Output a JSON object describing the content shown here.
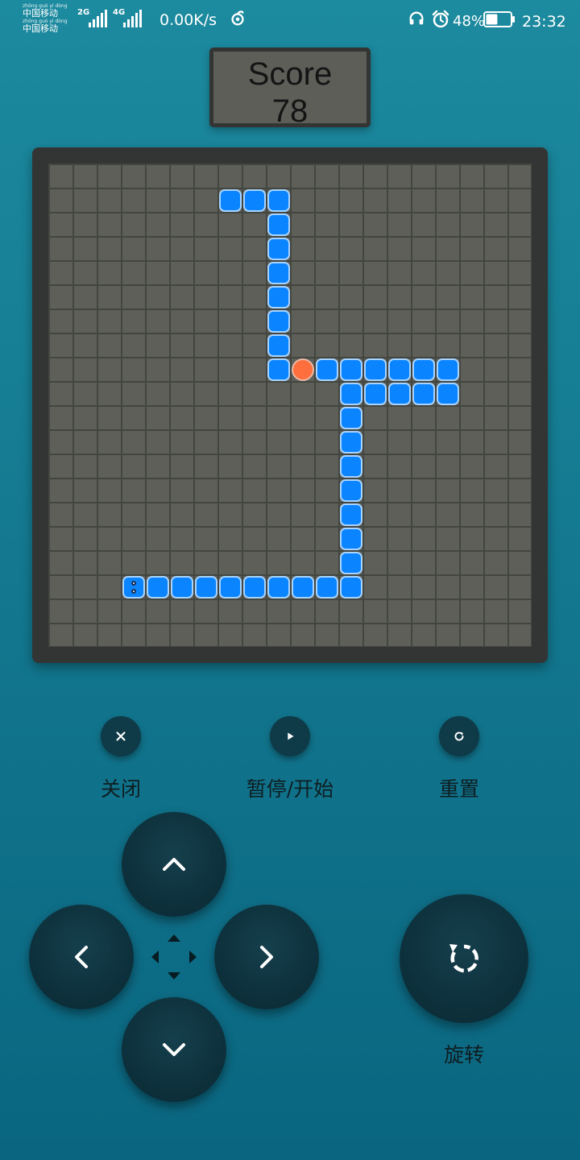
{
  "status_bar": {
    "carrier_pinyin_1": "zhōng guó  yí dòng",
    "carrier_text_1": "中国移动",
    "carrier_pinyin_2": "zhōng guó  yí dòng",
    "carrier_text_2": "中国移动",
    "network_1": "2G",
    "network_2": "4G",
    "net_speed": "0.00K/s",
    "battery_percent": "48%",
    "battery_level": 0.48,
    "time": "23:32",
    "icons": [
      "signal-icon",
      "wind-icon",
      "headset-icon",
      "alarm-icon",
      "battery-icon"
    ]
  },
  "score": {
    "label": "Score",
    "value": "78"
  },
  "board": {
    "columns": 20,
    "rows": 20,
    "snake_head": [
      3,
      17
    ],
    "snake_body": [
      [
        4,
        17
      ],
      [
        5,
        17
      ],
      [
        6,
        17
      ],
      [
        7,
        17
      ],
      [
        8,
        17
      ],
      [
        9,
        17
      ],
      [
        10,
        17
      ],
      [
        11,
        17
      ],
      [
        12,
        17
      ],
      [
        12,
        16
      ],
      [
        12,
        15
      ],
      [
        12,
        14
      ],
      [
        12,
        13
      ],
      [
        12,
        12
      ],
      [
        12,
        11
      ],
      [
        12,
        10
      ],
      [
        12,
        9
      ],
      [
        13,
        9
      ],
      [
        14,
        9
      ],
      [
        15,
        9
      ],
      [
        16,
        9
      ],
      [
        16,
        8
      ],
      [
        15,
        8
      ],
      [
        14,
        8
      ],
      [
        13,
        8
      ],
      [
        12,
        8
      ],
      [
        11,
        8
      ],
      [
        9,
        8
      ],
      [
        9,
        7
      ],
      [
        9,
        6
      ],
      [
        9,
        5
      ],
      [
        9,
        4
      ],
      [
        9,
        3
      ],
      [
        9,
        2
      ],
      [
        9,
        1
      ],
      [
        8,
        1
      ],
      [
        7,
        1
      ]
    ],
    "food": [
      10,
      8
    ],
    "colors": {
      "snake": "#0a84ff",
      "snake_border": "#a9d4ff",
      "food": "#ff6f3d",
      "board": "#5d5f58",
      "grid": "#434640"
    }
  },
  "controls": {
    "close_label": "关闭",
    "pause_label": "暂停/开始",
    "reset_label": "重置",
    "rotate_label": "旋转"
  },
  "theme": {
    "background": "#1c8a9f",
    "button": "#0f3a47"
  }
}
